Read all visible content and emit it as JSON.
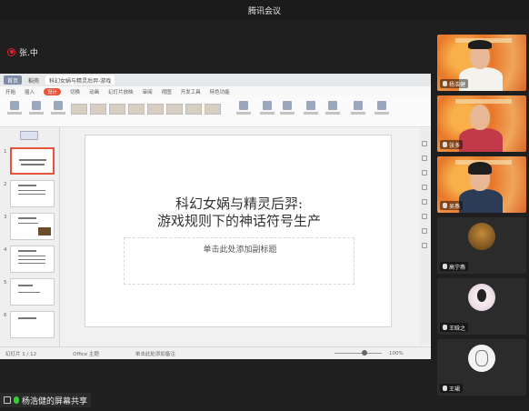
{
  "app": {
    "title": "腾讯会议"
  },
  "speaker": {
    "label": "张.中"
  },
  "wps": {
    "tabs": [
      {
        "label": "首页"
      },
      {
        "label": "稻壳"
      },
      {
        "label": "科幻女娲与精灵后羿-游戏"
      }
    ],
    "menu": [
      "开始",
      "插入",
      "设计",
      "切换",
      "动画",
      "幻灯片放映",
      "审阅",
      "视图",
      "开发工具",
      "特色功能"
    ],
    "active_menu_index": 2,
    "slide": {
      "title_line1": "科幻女娲与精灵后羿:",
      "title_line2": "游戏规则下的神话符号生产",
      "subtitle": "单击此处添加副标题"
    },
    "slide_numbers": [
      "1",
      "2",
      "3",
      "4",
      "5",
      "6"
    ],
    "status": {
      "page": "幻灯片 1 / 12",
      "theme": "Office 主题",
      "notes": "单击此处添加备注",
      "zoom": "100%"
    }
  },
  "participants": [
    {
      "name": "杨浩健",
      "kind": "video"
    },
    {
      "name": "张多",
      "kind": "video"
    },
    {
      "name": "吴燕",
      "kind": "video"
    },
    {
      "name": "高宁燕",
      "kind": "avatar"
    },
    {
      "name": "王晗之",
      "kind": "avatar"
    },
    {
      "name": "王珺",
      "kind": "avatar"
    }
  ],
  "footer": {
    "share_label": "杨浩健的屏幕共享"
  },
  "colors": {
    "accent": "#e8533a",
    "background": "#1f1f1f"
  }
}
